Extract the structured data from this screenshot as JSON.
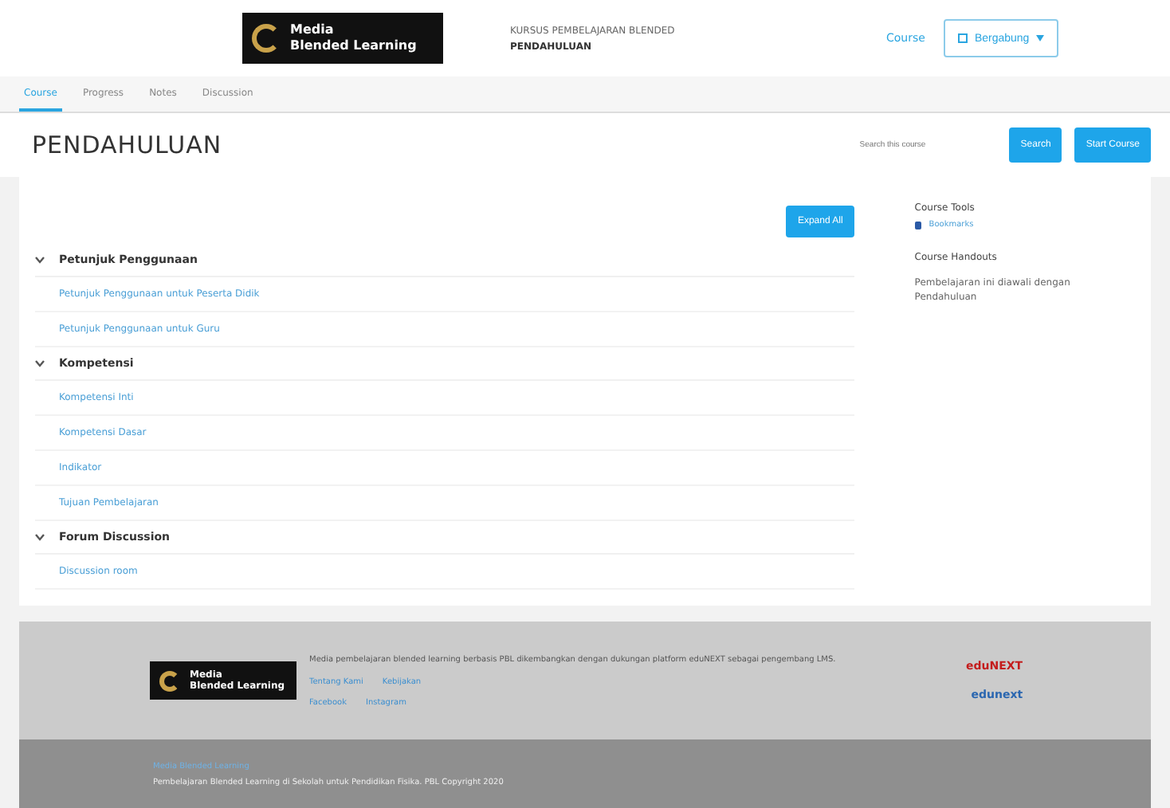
{
  "header": {
    "logo_line1": "Media",
    "logo_line2": "Blended Learning",
    "breadcrumb": "KURSUS PEMBELAJARAN BLENDED",
    "course_name": "PENDAHULUAN",
    "course_link": "Course",
    "dropdown": "Bergabung"
  },
  "tabs": [
    {
      "label": "Course",
      "selected": true
    },
    {
      "label": "Progress",
      "selected": false
    },
    {
      "label": "Notes",
      "selected": false
    },
    {
      "label": "Discussion",
      "selected": false
    }
  ],
  "page_title": "PENDAHULUAN",
  "search": {
    "placeholder": "Search this course",
    "button": "Search"
  },
  "start_button": "Start Course",
  "expand_button": "Expand All",
  "sections": [
    {
      "title": "Petunjuk Penggunaan",
      "expanded": true,
      "items": [
        "Petunjuk Penggunaan untuk Peserta Didik",
        "Petunjuk Penggunaan untuk Guru"
      ]
    },
    {
      "title": "Kompetensi",
      "expanded": true,
      "items": [
        "Kompetensi Inti",
        "Kompetensi Dasar",
        "Indikator",
        "Tujuan Pembelajaran"
      ]
    },
    {
      "title": "Forum Discussion",
      "expanded": true,
      "items": [
        "Discussion room"
      ]
    }
  ],
  "sidebar": {
    "tools_title": "Course Tools",
    "tools": [
      {
        "label": "Bookmarks"
      }
    ],
    "handouts_title": "Course Handouts",
    "handouts_text": "Pembelajaran ini diawali dengan Pendahuluan"
  },
  "footer": {
    "logo_line1": "Media",
    "logo_line2": "Blended Learning",
    "description": "Media pembelajaran blended learning berbasis PBL dikembangkan dengan dukungan platform eduNEXT sebagai pengembang LMS.",
    "links": [
      "Tentang Kami",
      "Kebijakan"
    ],
    "social": [
      "Facebook",
      "Instagram"
    ],
    "partner_top": "eduNEXT",
    "partner_bottom": "edunext",
    "bottom_link": "Media Blended Learning",
    "copyright": "Pembelajaran Blended Learning di Sekolah untuk Pendidikan Fisika. PBL Copyright 2020"
  }
}
